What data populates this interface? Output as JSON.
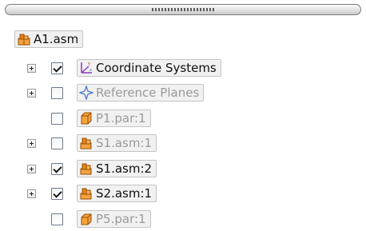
{
  "tree": {
    "root": {
      "label": "A1.asm",
      "icon": "assembly-icon"
    },
    "items": [
      {
        "label": "Coordinate Systems",
        "icon": "coordinate-system-icon",
        "expandable": true,
        "checked": true,
        "dimmed": false
      },
      {
        "label": "Reference Planes",
        "icon": "reference-plane-icon",
        "expandable": true,
        "checked": false,
        "dimmed": true
      },
      {
        "label": "P1.par:1",
        "icon": "part-icon",
        "expandable": false,
        "checked": false,
        "dimmed": true
      },
      {
        "label": "S1.asm:1",
        "icon": "subassembly-icon",
        "expandable": true,
        "checked": false,
        "dimmed": true
      },
      {
        "label": "S1.asm:2",
        "icon": "subassembly-icon",
        "expandable": true,
        "checked": true,
        "dimmed": false
      },
      {
        "label": "S2.asm:1",
        "icon": "subassembly-icon",
        "expandable": true,
        "checked": true,
        "dimmed": false
      },
      {
        "label": "P5.par:1",
        "icon": "part-icon",
        "expandable": false,
        "checked": false,
        "dimmed": true
      }
    ]
  },
  "colors": {
    "assembly_orange": "#e8821a",
    "plane_blue": "#4a78c8",
    "coord_purple": "#8a3ab9"
  }
}
